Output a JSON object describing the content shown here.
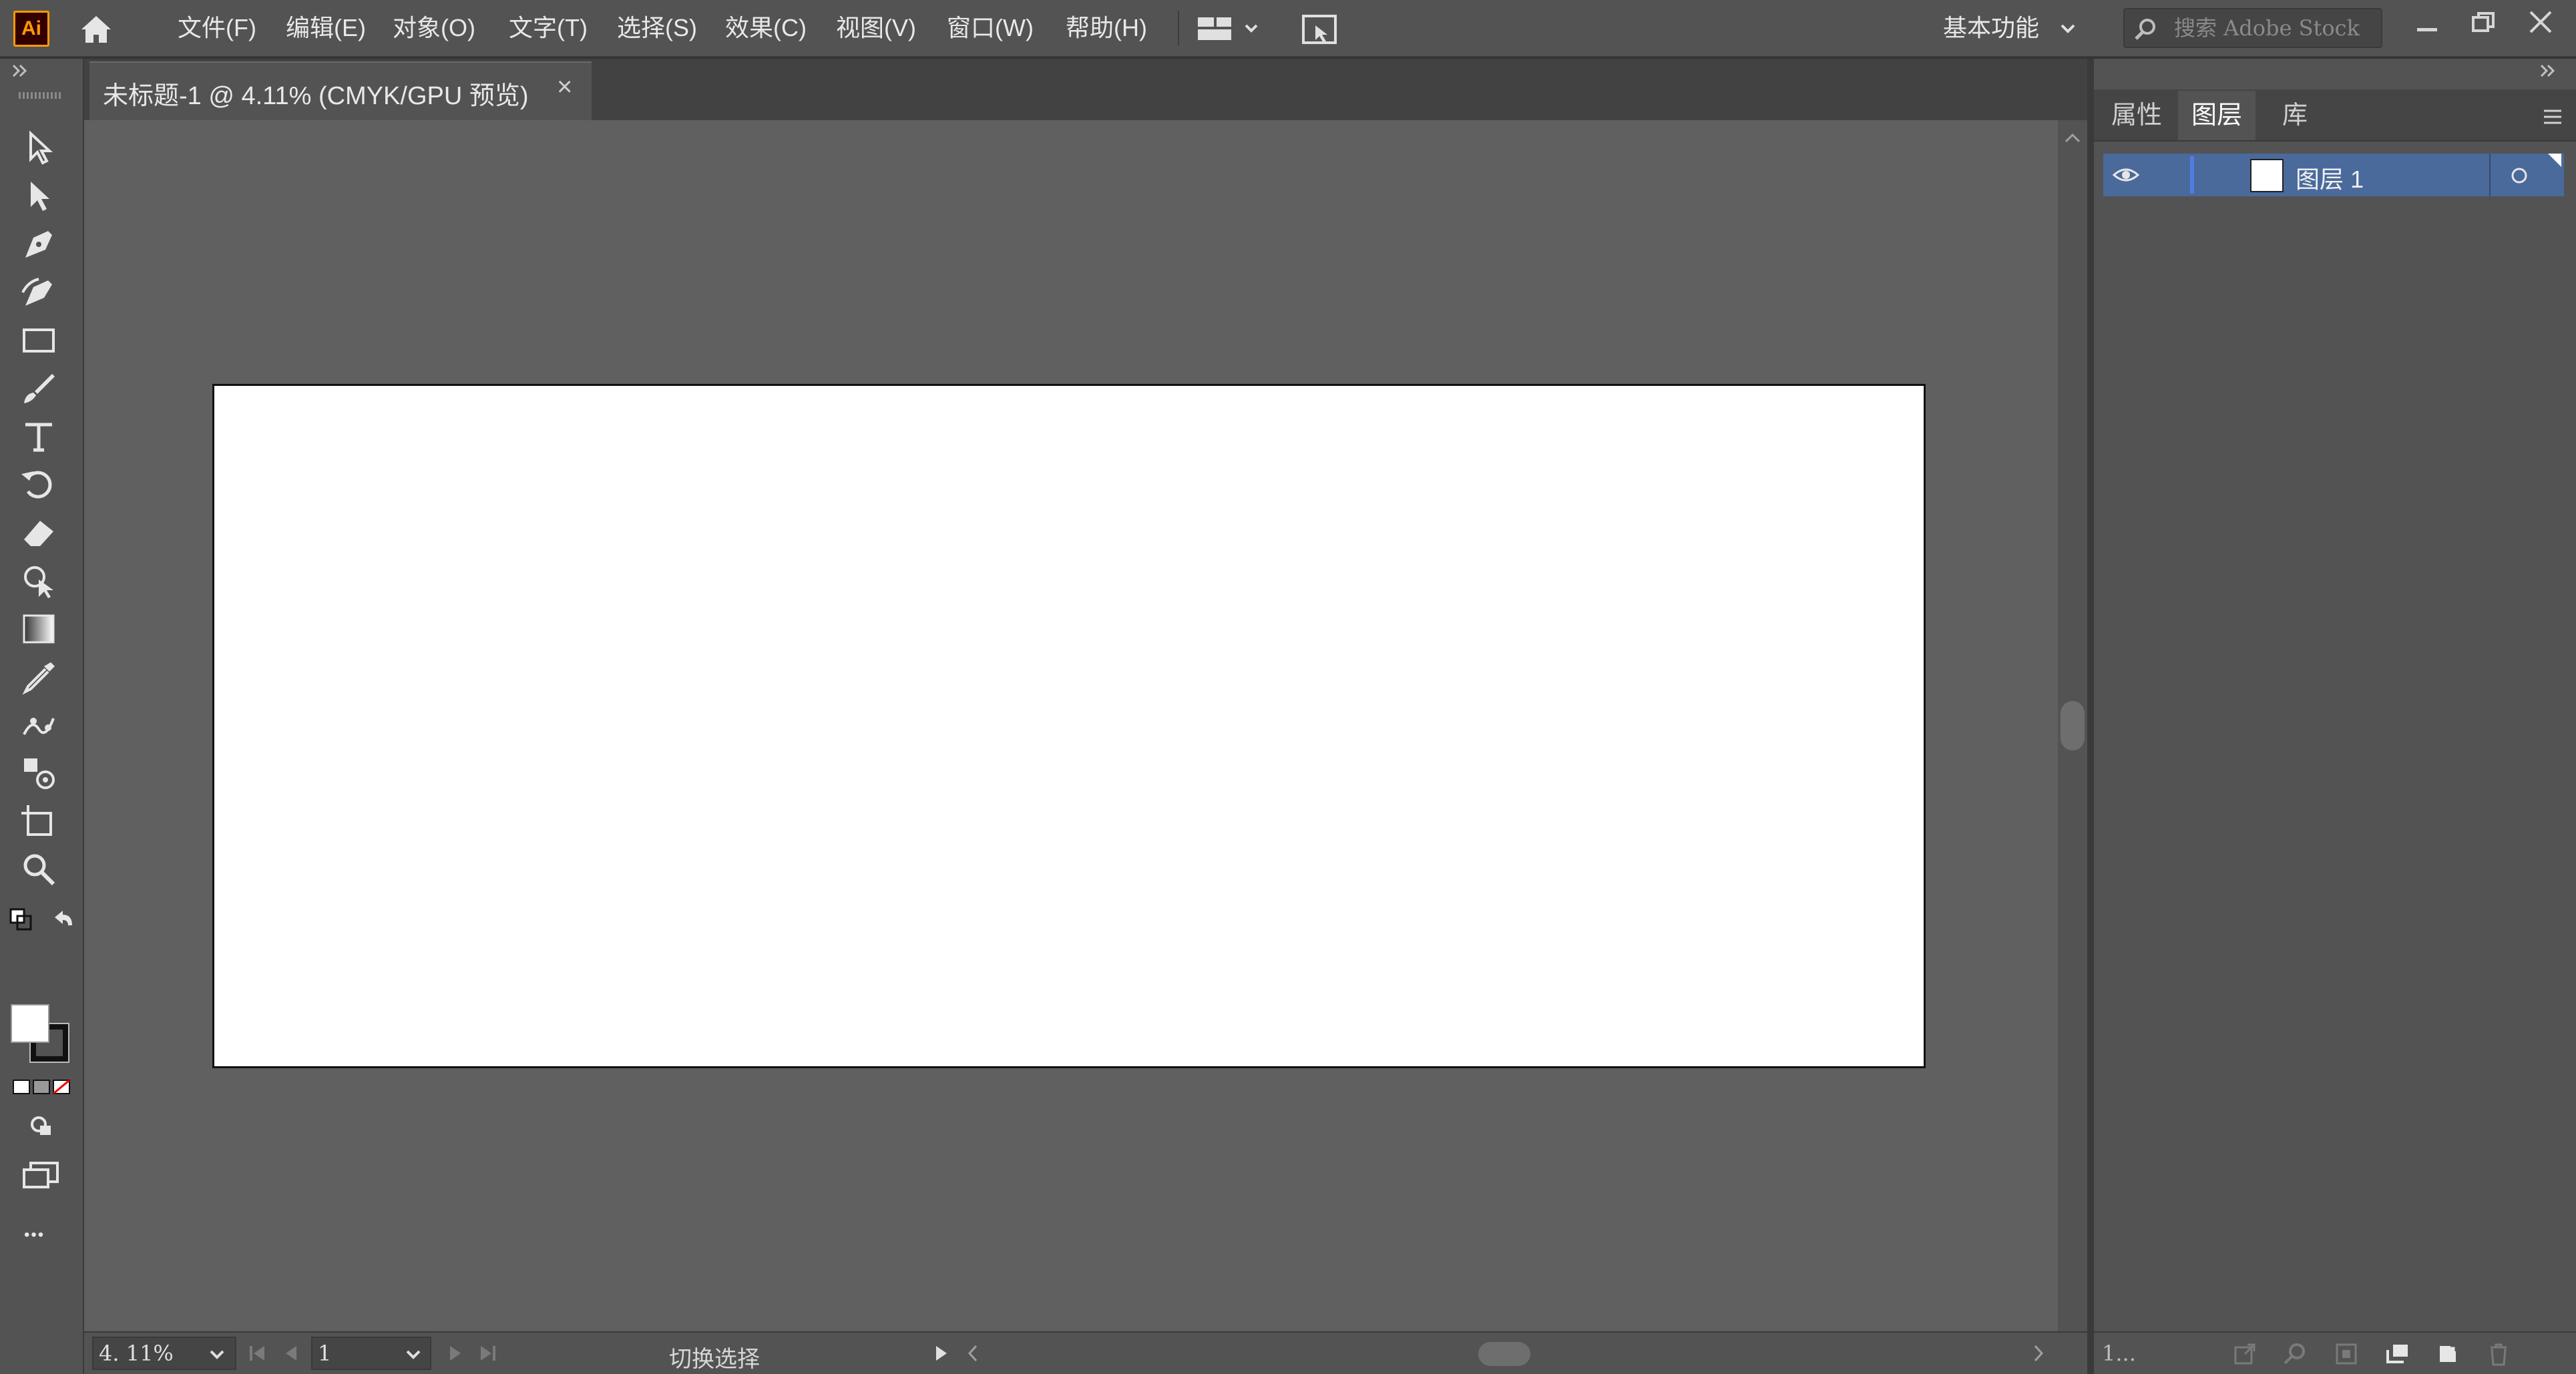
{
  "app": {
    "logo": "Ai",
    "accent": "#ff9a00"
  },
  "menu": {
    "items": [
      "文件(F)",
      "编辑(E)",
      "对象(O)",
      "文字(T)",
      "选择(S)",
      "效果(C)",
      "视图(V)",
      "窗口(W)",
      "帮助(H)"
    ],
    "workspace": "基本功能",
    "search_placeholder": "搜索 Adobe Stock"
  },
  "document": {
    "tab_title": "未标题-1 @ 4.11% (CMYK/GPU 预览)",
    "close_glyph": "×",
    "artboard_color": "#ffffff",
    "canvas_color": "#606060"
  },
  "status": {
    "zoom": "4. 11%",
    "artboard_number": "1",
    "status_text": "切换选择"
  },
  "panel": {
    "tabs": [
      "属性",
      "图层",
      "库"
    ],
    "active_tab": "图层",
    "layers": [
      {
        "name": "图层 1",
        "visible": true,
        "color": "#4f7de3"
      }
    ],
    "layer_count": "1..."
  },
  "toolbar": {
    "tools": [
      "selection-tool",
      "direct-selection-tool",
      "pen-tool",
      "curvature-tool",
      "rectangle-tool",
      "paintbrush-tool",
      "type-tool",
      "rotate-tool",
      "eraser-tool",
      "shape-builder-tool",
      "gradient-tool",
      "eyedropper-tool",
      "puppet-warp-tool",
      "symbol-sprayer-tool",
      "artboard-tool",
      "zoom-tool"
    ],
    "more_glyph": "•••"
  }
}
